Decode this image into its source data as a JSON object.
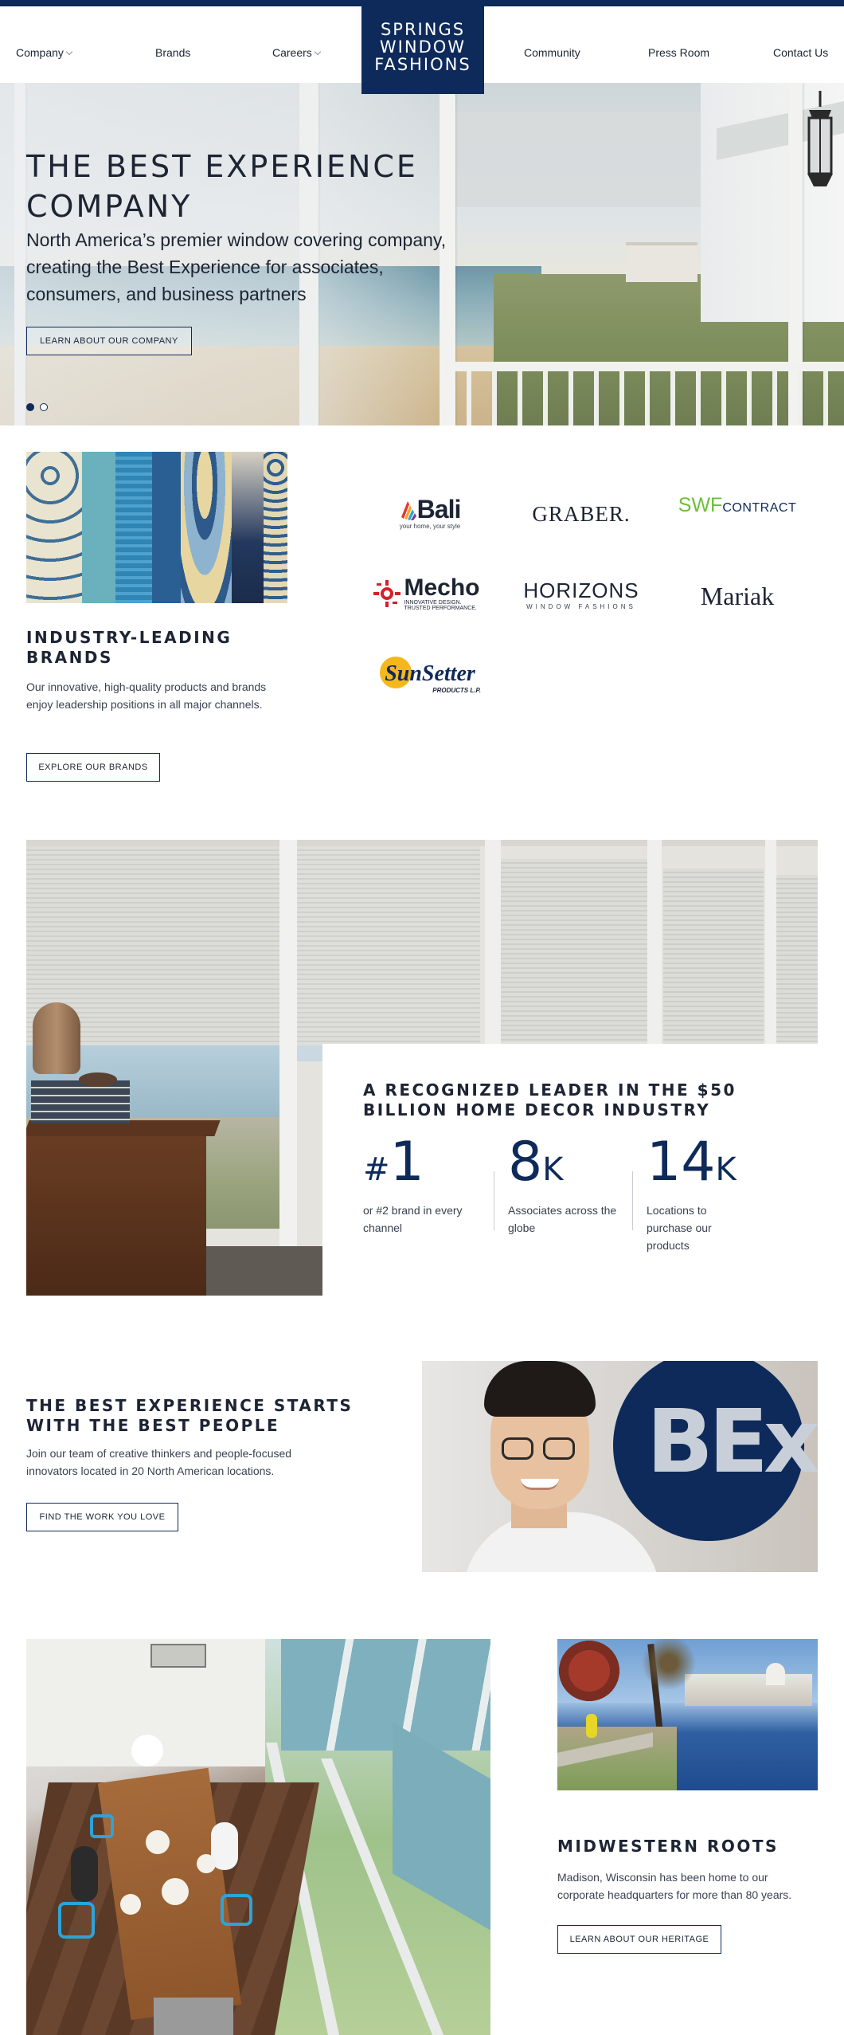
{
  "nav": {
    "left_items": [
      {
        "label": "Company",
        "has_dropdown": true
      },
      {
        "label": "Brands",
        "has_dropdown": false
      },
      {
        "label": "Careers",
        "has_dropdown": true
      }
    ],
    "right_items": [
      {
        "label": "Community"
      },
      {
        "label": "Press Room"
      },
      {
        "label": "Contact Us"
      }
    ],
    "logo_lines": [
      "SPRINGS",
      "WINDOW",
      "FASHIONS"
    ]
  },
  "hero": {
    "title_line1": "THE BEST EXPERIENCE",
    "title_line2": "COMPANY",
    "subtitle": "North America’s premier window covering company, creating the Best Experience for associates, consumers, and business partners",
    "button": "LEARN ABOUT OUR COMPANY",
    "slides": 2,
    "active_slide": 1
  },
  "brands_section": {
    "title": "INDUSTRY-LEADING BRANDS",
    "body": "Our innovative, high-quality products and brands enjoy leadership positions in all major channels.",
    "button": "EXPLORE OUR BRANDS",
    "logos": {
      "bali": {
        "name": "Bali",
        "tagline": "your home, your style"
      },
      "graber": {
        "name": "GRABER."
      },
      "swf": {
        "name": "SWF",
        "suffix": "CONTRACT"
      },
      "mecho": {
        "name": "Mecho",
        "tagline1": "INNOVATIVE DESIGN.",
        "tagline2": "TRUSTED PERFORMANCE."
      },
      "horizons": {
        "name": "HORIZONS",
        "tagline": "WINDOW FASHIONS"
      },
      "mariak": {
        "name": "Mariak"
      },
      "sunsetter": {
        "name": "SunSetter",
        "tagline": "PRODUCTS L.P."
      }
    }
  },
  "leader_section": {
    "title": "A RECOGNIZED LEADER IN THE $50 BILLION HOME DECOR INDUSTRY",
    "stats": [
      {
        "prefix": "#",
        "value": "1",
        "suffix": "",
        "label": "or #2 brand in every channel"
      },
      {
        "prefix": "",
        "value": "8",
        "suffix": "K",
        "label": "Associates across the globe"
      },
      {
        "prefix": "",
        "value": "14",
        "suffix": "K",
        "label": "Locations to purchase our products"
      }
    ]
  },
  "people_section": {
    "title": "THE BEST EXPERIENCE STARTS WITH THE BEST PEOPLE",
    "body": "Join our team of creative thinkers and people-focused innovators located in 20 North American locations.",
    "button": "FIND THE WORK YOU LOVE",
    "badge": "BEx"
  },
  "heritage_section": {
    "title": "MIDWESTERN ROOTS",
    "body": "Madison, Wisconsin has been home to our corporate headquarters for more than 80 years.",
    "button": "LEARN ABOUT OUR HERITAGE"
  },
  "colors": {
    "brand_navy": "#0d2a5a",
    "text": "#1d2433",
    "body_text": "#3a4150",
    "swf_green": "#6cbf3a",
    "mecho_red": "#d6202a",
    "sunsetter_yellow": "#f5b81c"
  }
}
